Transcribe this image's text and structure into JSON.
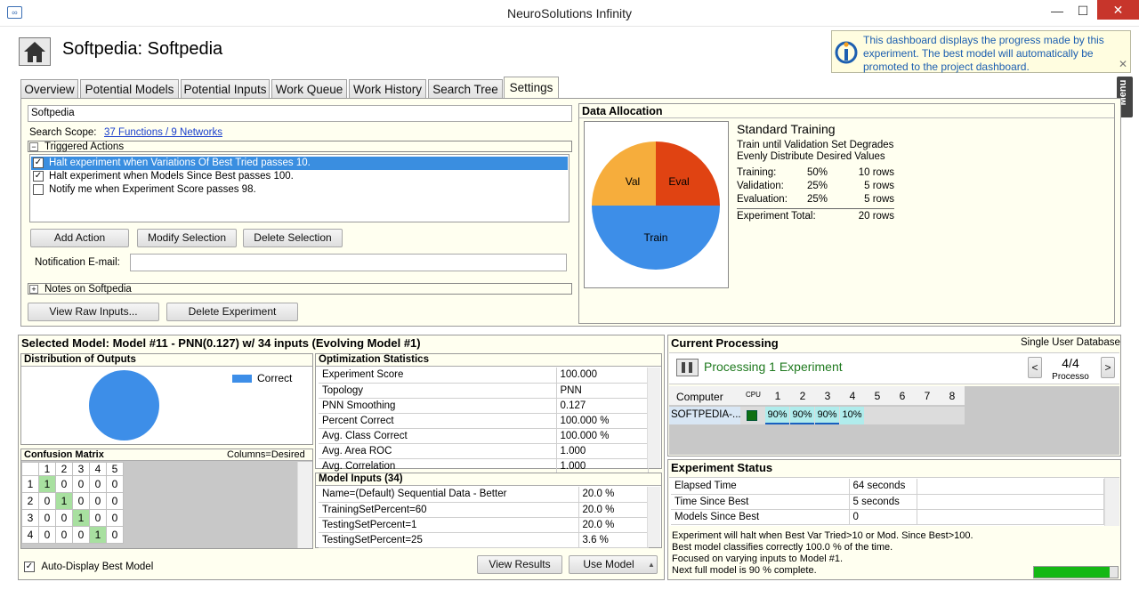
{
  "window": {
    "title": "NeuroSolutions Infinity",
    "app_icon": "∞",
    "minimize": "—",
    "maximize": "☐",
    "close": "✕"
  },
  "header": {
    "title": "Softpedia:  Softpedia",
    "info_text": "This dashboard displays the progress made by this experiment. The best model will automatically be promoted to the project dashboard.",
    "info_close": "✕",
    "menu_label": "Menu"
  },
  "tabs": [
    {
      "label": "Overview"
    },
    {
      "label": "Potential Models"
    },
    {
      "label": "Potential Inputs"
    },
    {
      "label": "Work Queue"
    },
    {
      "label": "Work History"
    },
    {
      "label": "Search Tree"
    },
    {
      "label": "Settings"
    }
  ],
  "settings": {
    "name_value": "Softpedia",
    "search_scope_label": "Search Scope:",
    "search_scope_link": "37 Functions / 9 Networks",
    "triggered_title": "Triggered Actions",
    "actions": [
      {
        "label": "Halt experiment when Variations Of Best Tried passes 10.",
        "checked": true
      },
      {
        "label": "Halt experiment when Models Since Best passes 100.",
        "checked": true
      },
      {
        "label": "Notify me when Experiment Score passes 98.",
        "checked": false
      }
    ],
    "add_action": "Add Action",
    "modify_selection": "Modify Selection",
    "delete_selection": "Delete Selection",
    "email_label": "Notification E-mail:",
    "email_value": "",
    "notes_title": "Notes on Softpedia",
    "view_raw": "View Raw Inputs...",
    "delete_experiment": "Delete Experiment"
  },
  "data_allocation": {
    "title": "Data Allocation",
    "training_title": "Standard Training",
    "line1": "Train until Validation Set Degrades",
    "line2": "Evenly Distribute Desired Values",
    "rows": [
      {
        "label": "Training:",
        "pct": "50%",
        "rows": "10 rows"
      },
      {
        "label": "Validation:",
        "pct": "25%",
        "rows": "5 rows"
      },
      {
        "label": "Evaluation:",
        "pct": "25%",
        "rows": "5 rows"
      }
    ],
    "total_label": "Experiment Total:",
    "total_rows": "20 rows",
    "pie": [
      {
        "name": "Train",
        "value": 50,
        "color": "#3d8ee8"
      },
      {
        "name": "Val",
        "value": 25,
        "color": "#f6ad3c"
      },
      {
        "name": "Eval",
        "value": 25,
        "color": "#e04312"
      }
    ]
  },
  "selected_model": {
    "title": "Selected Model: Model #11 - PNN(0.127) w/ 34 inputs (Evolving Model #1)",
    "dist_title": "Distribution of Outputs",
    "dist_legend": "Correct",
    "dist_color": "#3d8ee8",
    "opt_title": "Optimization Statistics",
    "opt_rows": [
      {
        "k": "Experiment Score",
        "v": "100.000"
      },
      {
        "k": "Topology",
        "v": "PNN"
      },
      {
        "k": "PNN Smoothing",
        "v": "0.127"
      },
      {
        "k": "Percent Correct",
        "v": "100.000 %"
      },
      {
        "k": "Avg. Class Correct",
        "v": "100.000 %"
      },
      {
        "k": "Avg. Area ROC",
        "v": "1.000"
      },
      {
        "k": "Avg. Correlation",
        "v": "1.000"
      }
    ],
    "cm_title": "Confusion Matrix",
    "cm_columns": "Columns=Desired",
    "cm_headers": [
      "1",
      "2",
      "3",
      "4",
      "5"
    ],
    "cm_rows": [
      {
        "h": "1",
        "c": [
          "1",
          "0",
          "0",
          "0",
          "0"
        ]
      },
      {
        "h": "2",
        "c": [
          "0",
          "1",
          "0",
          "0",
          "0"
        ]
      },
      {
        "h": "3",
        "c": [
          "0",
          "0",
          "1",
          "0",
          "0"
        ]
      },
      {
        "h": "4",
        "c": [
          "0",
          "0",
          "0",
          "1",
          "0"
        ]
      }
    ],
    "inputs_title": "Model Inputs (34)",
    "inputs": [
      {
        "k": "Name=(Default) Sequential Data - Better",
        "v": "20.0 %"
      },
      {
        "k": "TrainingSetPercent=60",
        "v": "20.0 %"
      },
      {
        "k": "TestingSetPercent=1",
        "v": "20.0 %"
      },
      {
        "k": "TestingSetPercent=25",
        "v": "3.6 %"
      }
    ],
    "auto_display": "Auto-Display Best Model",
    "view_results": "View Results",
    "use_model": "Use Model"
  },
  "current_processing": {
    "title": "Current Processing",
    "db": "Single User Database",
    "status": "Processing 1 Experiment",
    "page": "4/4",
    "processor_label": "Processo",
    "computer_header": "Computer",
    "cpu_header": "CPU",
    "cols": [
      "1",
      "2",
      "3",
      "4",
      "5",
      "6",
      "7",
      "8"
    ],
    "computer": "SOFTPEDIA-...",
    "loads": [
      "90%",
      "90%",
      "90%",
      "10%"
    ]
  },
  "experiment_status": {
    "title": "Experiment Status",
    "rows": [
      {
        "k": "Elapsed Time",
        "v": "64 seconds"
      },
      {
        "k": "Time Since Best",
        "v": "5 seconds"
      },
      {
        "k": "Models Since Best",
        "v": "0"
      }
    ],
    "messages": [
      "Experiment will halt when Best Var Tried>10 or Mod. Since Best>100.",
      "Best model classifies correctly 100.0 % of the time.",
      "Focused on varying inputs to Model #1.",
      "Next full model is 90 % complete."
    ],
    "progress": 0.9
  }
}
